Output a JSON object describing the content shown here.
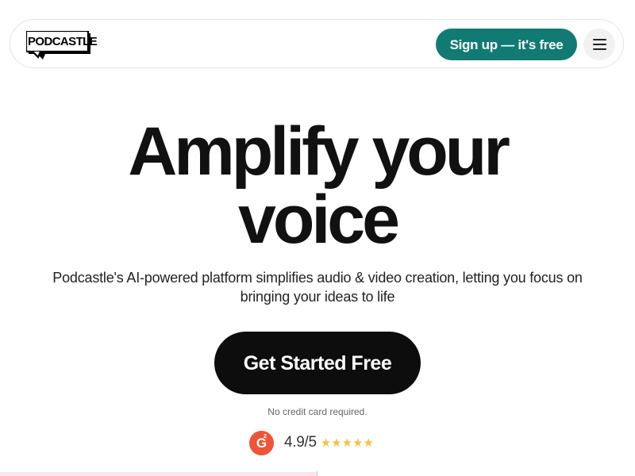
{
  "header": {
    "logo_text": "PODCASTLE",
    "signup_label": "Sign up — it's free",
    "menu_icon": "hamburger-icon"
  },
  "hero": {
    "headline_line1": "Amplify your",
    "headline_line2": "voice",
    "subtitle": "Podcastle's AI-powered platform simplifies audio & video creation, letting you focus on bringing your ideas to life",
    "cta_label": "Get Started Free",
    "note": "No credit card required."
  },
  "rating": {
    "badge_icon": "g2-icon",
    "badge_letter": "G",
    "badge_superscript": "2",
    "value": "4.9/5",
    "stars": "★★★★★",
    "star_count": 5
  },
  "colors": {
    "brand_teal": "#117b73",
    "cta_black": "#0d0d0d",
    "g2_orange": "#ee5437",
    "star_gold": "#f5c242",
    "strip_pink": "#fbe4ee"
  }
}
